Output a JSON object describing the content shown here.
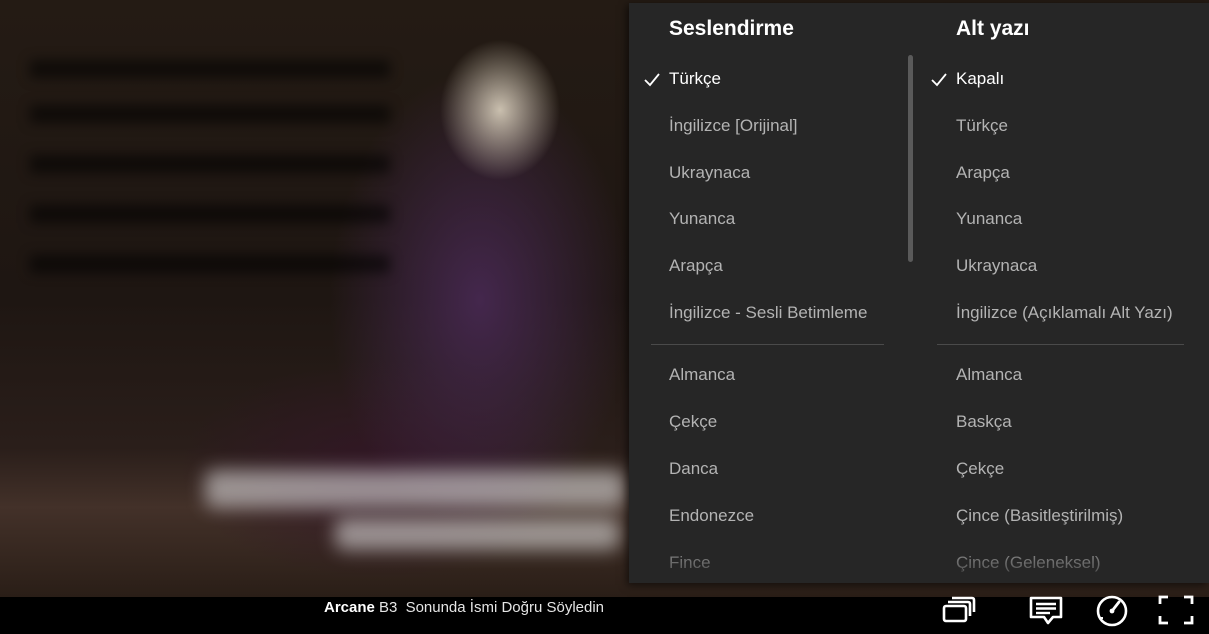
{
  "audio": {
    "title": "Seslendirme",
    "selected_index": 0,
    "items": [
      "Türkçe",
      "İngilizce [Orijinal]",
      "Ukraynaca",
      "Yunanca",
      "Arapça",
      "İngilizce - Sesli Betimleme",
      "Almanca",
      "Çekçe",
      "Danca",
      "Endonezce",
      "Fince"
    ]
  },
  "subtitles": {
    "title": "Alt yazı",
    "selected_index": 0,
    "items": [
      "Kapalı",
      "Türkçe",
      "Arapça",
      "Yunanca",
      "Ukraynaca",
      "İngilizce (Açıklamalı Alt Yazı)",
      "Almanca",
      "Baskça",
      "Çekçe",
      "Çince (Basitleştirilmiş)",
      "Çince (Geleneksel)"
    ]
  },
  "now_playing": {
    "show": "Arcane",
    "episode": "B3",
    "episode_title": "Sonunda İsmi Doğru Söyledin"
  },
  "controls": {
    "episodes_icon": "episodes-icon",
    "subtitles_icon": "subtitles-icon",
    "speed_icon": "playback-speed-icon",
    "fullscreen_icon": "fullscreen-icon"
  },
  "colors": {
    "menu_bg": "#262626",
    "selected_text": "#ffffff",
    "unselected_text": "#b3b3b3"
  }
}
